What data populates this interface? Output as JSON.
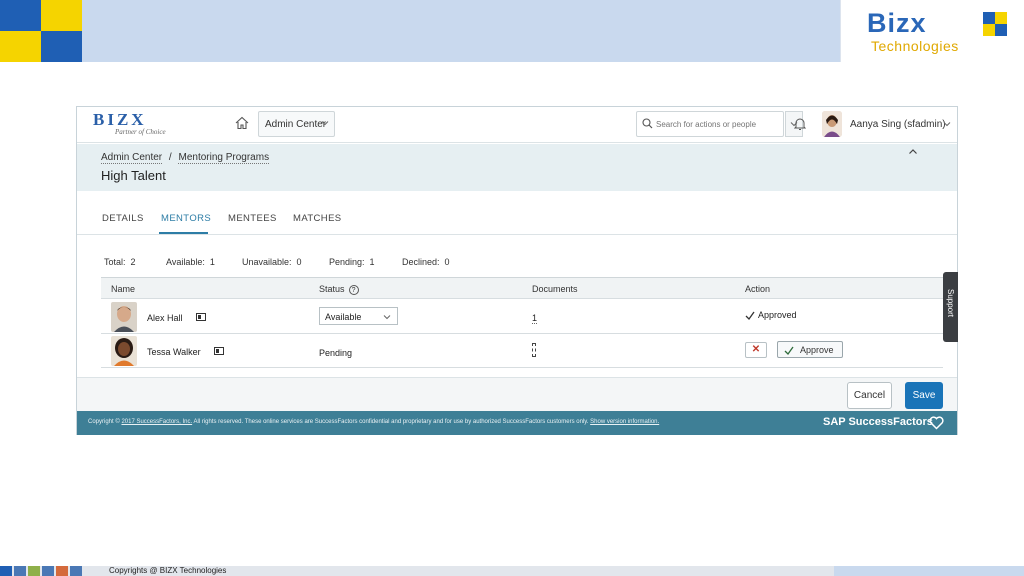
{
  "slide": {
    "brand_title": "Bizx",
    "brand_subtitle": "Technologies",
    "footer_text": "Copyrights @ BIZX Technologies"
  },
  "app": {
    "logo_title": "BIZX",
    "logo_subtitle": "Partner of Choice",
    "admin_center_label": "Admin Center",
    "search": {
      "placeholder": "Search for actions or people"
    },
    "user_name": "Aanya Sing (sfadmin)"
  },
  "title_area": {
    "breadcrumb": [
      "Admin Center",
      "Mentoring Programs"
    ],
    "breadcrumb_separator": "/",
    "page_title": "High Talent"
  },
  "tabs": [
    {
      "label": "DETAILS",
      "active": false
    },
    {
      "label": "MENTORS",
      "active": true
    },
    {
      "label": "MENTEES",
      "active": false
    },
    {
      "label": "MATCHES",
      "active": false
    }
  ],
  "counts": [
    {
      "label": "Total:",
      "value": "2"
    },
    {
      "label": "Available:",
      "value": "1"
    },
    {
      "label": "Unavailable:",
      "value": "0"
    },
    {
      "label": "Pending:",
      "value": "1"
    },
    {
      "label": "Declined:",
      "value": "0"
    }
  ],
  "table": {
    "columns": [
      "Name",
      "Status",
      "Documents",
      "Action"
    ],
    "rows": [
      {
        "name": "Alex Hall",
        "status": "Available",
        "documents": "1",
        "action": "Approved"
      },
      {
        "name": "Tessa Walker",
        "status": "Pending",
        "documents": "",
        "approve_label": "Approve"
      }
    ]
  },
  "footer": {
    "cancel_label": "Cancel",
    "save_label": "Save",
    "copyright_prefix": "Copyright ©",
    "copyright_link": "2017 SuccessFactors, Inc.",
    "copyright_body": "All rights reserved. These online services are SuccessFactors confidential and proprietary and for use by authorized SuccessFactors customers only.",
    "version_link": "Show version information.",
    "sap_brand": "SAP SuccessFactors"
  },
  "support_label": "Support",
  "colors": {
    "accent": "#2d7da6",
    "save": "#1a74b8",
    "footer_band": "#3e7f96"
  }
}
